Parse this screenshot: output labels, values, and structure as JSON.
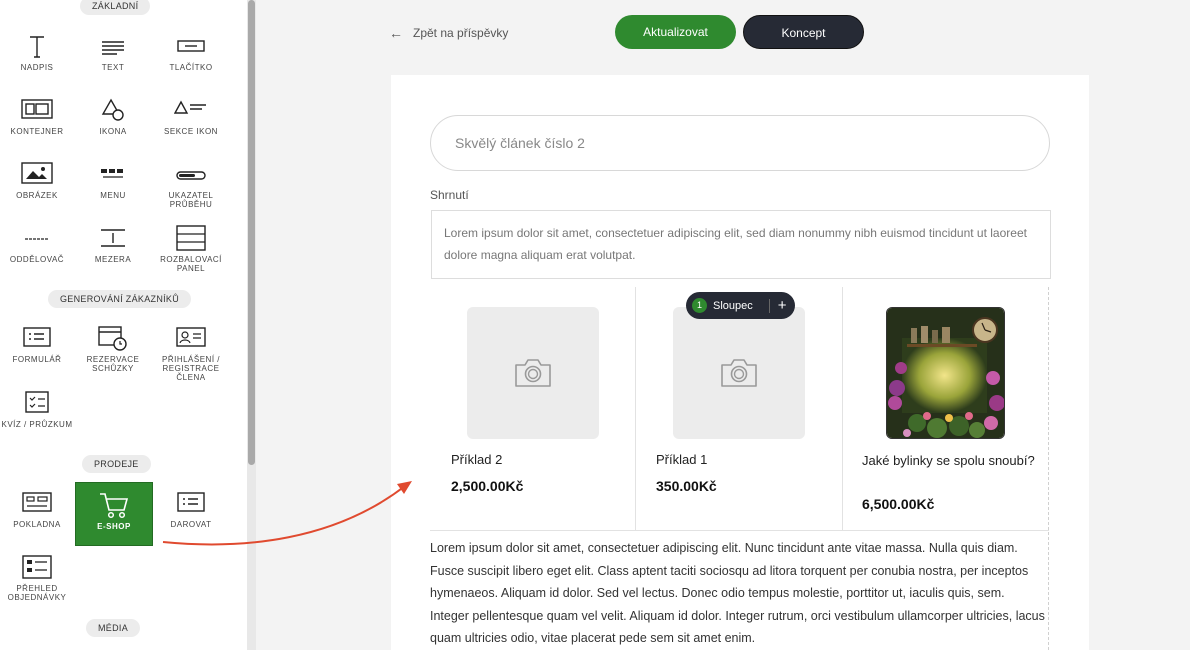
{
  "sidebar": {
    "sections": {
      "basic": "ZÁKLADNÍ",
      "customer_gen": "GENEROVÁNÍ ZÁKAZNÍKŮ",
      "sales": "PRODEJE",
      "media": "MÉDIA"
    },
    "tools": {
      "heading": "NADPIS",
      "text": "TEXT",
      "button": "TLAČÍTKO",
      "container": "KONTEJNER",
      "icon": "IKONA",
      "icon_section": "SEKCE IKON",
      "image": "OBRÁZEK",
      "menu": "MENU",
      "progress": "UKAZATEL PRŮBĚHU",
      "divider": "ODDĚLOVAČ",
      "spacer": "MEZERA",
      "collapsible": "ROZBALOVACÍ PANEL",
      "form": "FORMULÁŘ",
      "booking": "REZERVACE SCHŮZKY",
      "member_login": "PŘIHLÁŠENÍ / REGISTRACE ČLENA",
      "quiz": "KVÍZ / PRŮZKUM",
      "checkout": "POKLADNA",
      "eshop": "E-SHOP",
      "donate": "DAROVAT",
      "order_summary": "PŘEHLED OBJEDNÁVKY"
    }
  },
  "header": {
    "back_label": "Zpět na příspěvky",
    "update_label": "Aktualizovat",
    "draft_label": "Koncept"
  },
  "post": {
    "title": "Skvělý článek číslo 2",
    "summary_label": "Shrnutí",
    "summary_text": "Lorem ipsum dolor sit amet, consectetuer adipiscing elit, sed diam nonummy nibh euismod tincidunt ut laoreet dolore magna aliquam erat volutpat.",
    "column_chip": {
      "number": "1",
      "label": "Sloupec",
      "plus": "+"
    },
    "products": [
      {
        "name": "Příklad 2",
        "price": "2,500.00Kč"
      },
      {
        "name": "Příklad 1",
        "price": "350.00Kč"
      },
      {
        "name": "Jaké bylinky se spolu snoubí?",
        "price": "6,500.00Kč"
      }
    ],
    "body_text": "Lorem ipsum dolor sit amet, consectetuer adipiscing elit. Nunc tincidunt ante vitae massa. Nulla quis diam. Fusce suscipit libero eget elit. Class aptent taciti sociosqu ad litora torquent per conubia nostra, per inceptos hymenaeos. Aliquam id dolor. Sed vel lectus. Donec odio tempus molestie, porttitor ut, iaculis quis, sem. Integer pellentesque quam vel velit. Aliquam id dolor. Integer rutrum, orci vestibulum ullamcorper ultricies, lacus quam ultricies odio, vitae placerat pede sem sit amet enim."
  },
  "colors": {
    "primary_green": "#2f8a2f",
    "dark": "#262a35",
    "arrow": "#e04a2f"
  }
}
